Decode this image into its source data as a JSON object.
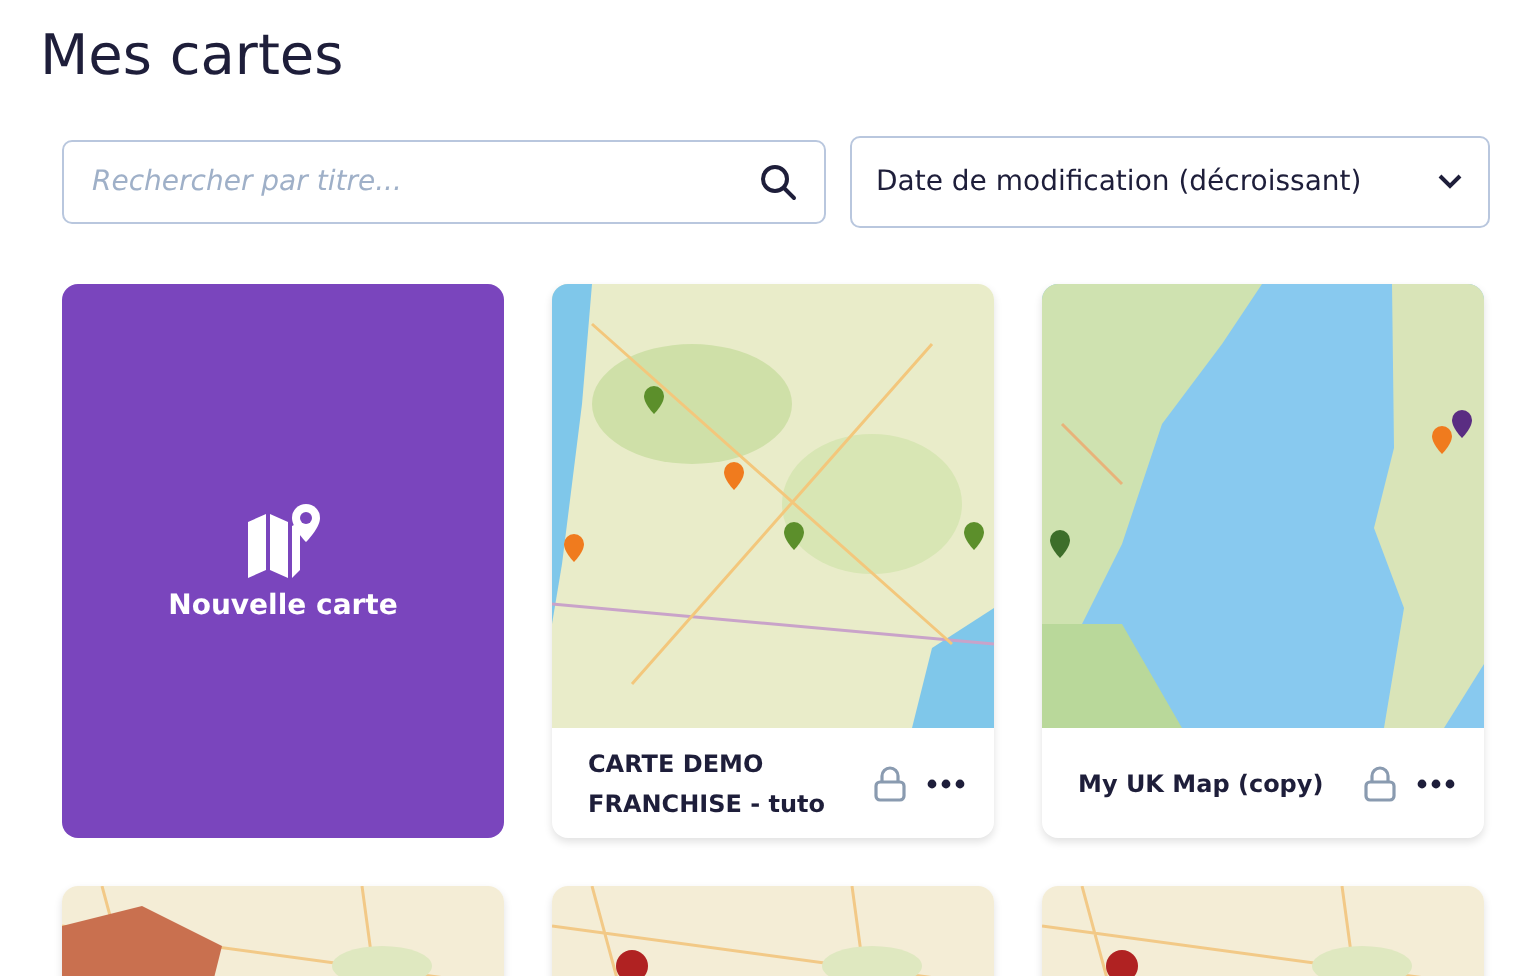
{
  "title": "Mes cartes",
  "search": {
    "placeholder": "Rechercher par titre..."
  },
  "sort": {
    "value": "Date de modification (décroissant)"
  },
  "cards": [
    {
      "kind": "new",
      "label": "Nouvelle carte"
    },
    {
      "kind": "map",
      "title": "CARTE DEMO FRANCHISE - tuto"
    },
    {
      "kind": "map",
      "title": "My UK Map (copy)"
    },
    {
      "kind": "preview"
    },
    {
      "kind": "preview"
    },
    {
      "kind": "preview"
    }
  ]
}
